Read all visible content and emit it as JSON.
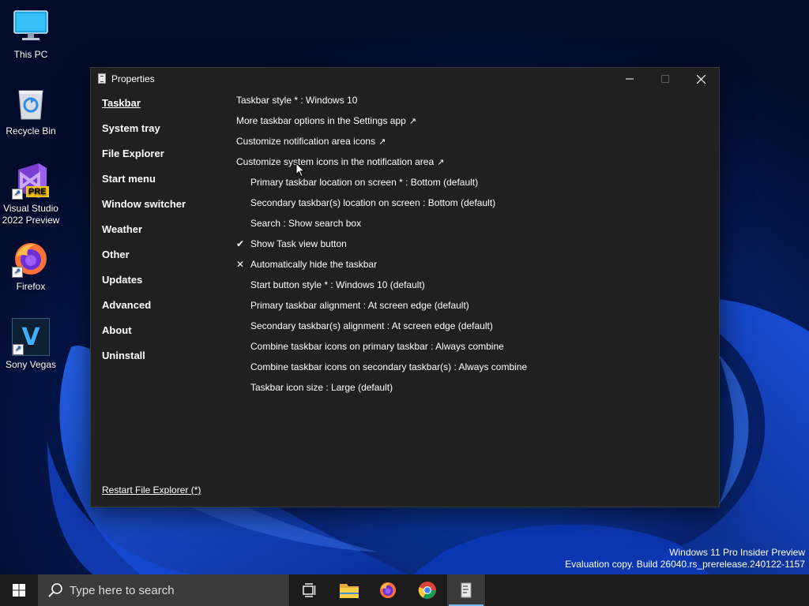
{
  "desktop": {
    "icons": [
      {
        "label": "This PC",
        "icon": "computer-icon"
      },
      {
        "label": "Recycle Bin",
        "icon": "recycle-bin-icon"
      },
      {
        "label": "Visual Studio 2022 Preview",
        "icon": "visual-studio-icon",
        "badge": "PRE"
      },
      {
        "label": "Firefox",
        "icon": "firefox-icon"
      },
      {
        "label": "Sony Vegas",
        "icon": "sony-vegas-icon",
        "glyph": "V"
      }
    ]
  },
  "window": {
    "title": "Properties",
    "sidebar": [
      {
        "label": "Taskbar",
        "active": true
      },
      {
        "label": "System tray"
      },
      {
        "label": "File Explorer"
      },
      {
        "label": "Start menu"
      },
      {
        "label": "Window switcher"
      },
      {
        "label": "Weather"
      },
      {
        "label": "Other"
      },
      {
        "label": "Updates"
      },
      {
        "label": "Advanced"
      },
      {
        "label": "About"
      },
      {
        "label": "Uninstall"
      }
    ],
    "restart_label": "Restart File Explorer (*)",
    "settings": [
      {
        "text": "Taskbar style * : Windows 10"
      },
      {
        "text": "More taskbar options in the Settings app",
        "ext": "↗"
      },
      {
        "text": "Customize notification area icons",
        "ext": "↗"
      },
      {
        "text": "Customize system icons in the notification area",
        "ext": "↗"
      },
      {
        "text": "Primary taskbar location on screen * : Bottom (default)"
      },
      {
        "text": "Secondary taskbar(s) location on screen : Bottom (default)"
      },
      {
        "text": "Search : Show search box"
      },
      {
        "text": "Show Task view button",
        "mark": "✔"
      },
      {
        "text": "Automatically hide the taskbar",
        "mark": "✕"
      },
      {
        "text": "Start button style * : Windows 10 (default)"
      },
      {
        "text": "Primary taskbar alignment : At screen edge (default)"
      },
      {
        "text": "Secondary taskbar(s) alignment : At screen edge (default)"
      },
      {
        "text": "Combine taskbar icons on primary taskbar : Always combine"
      },
      {
        "text": "Combine taskbar icons on secondary taskbar(s) : Always combine"
      },
      {
        "text": "Taskbar icon size : Large (default)"
      }
    ]
  },
  "watermark": {
    "line1": "Windows 11 Pro Insider Preview",
    "line2": "Evaluation copy. Build 26040.rs_prerelease.240122-1157"
  },
  "taskbar": {
    "search_placeholder": "Type here to search",
    "apps": [
      "task-view-icon",
      "file-explorer-icon",
      "firefox-icon",
      "chrome-icon",
      "properties-app-icon"
    ],
    "active_app": "properties-app-icon"
  },
  "colors": {
    "window_bg": "#202020",
    "taskbar_bg": "#1c1c1c",
    "accent": "#76b9ed"
  }
}
